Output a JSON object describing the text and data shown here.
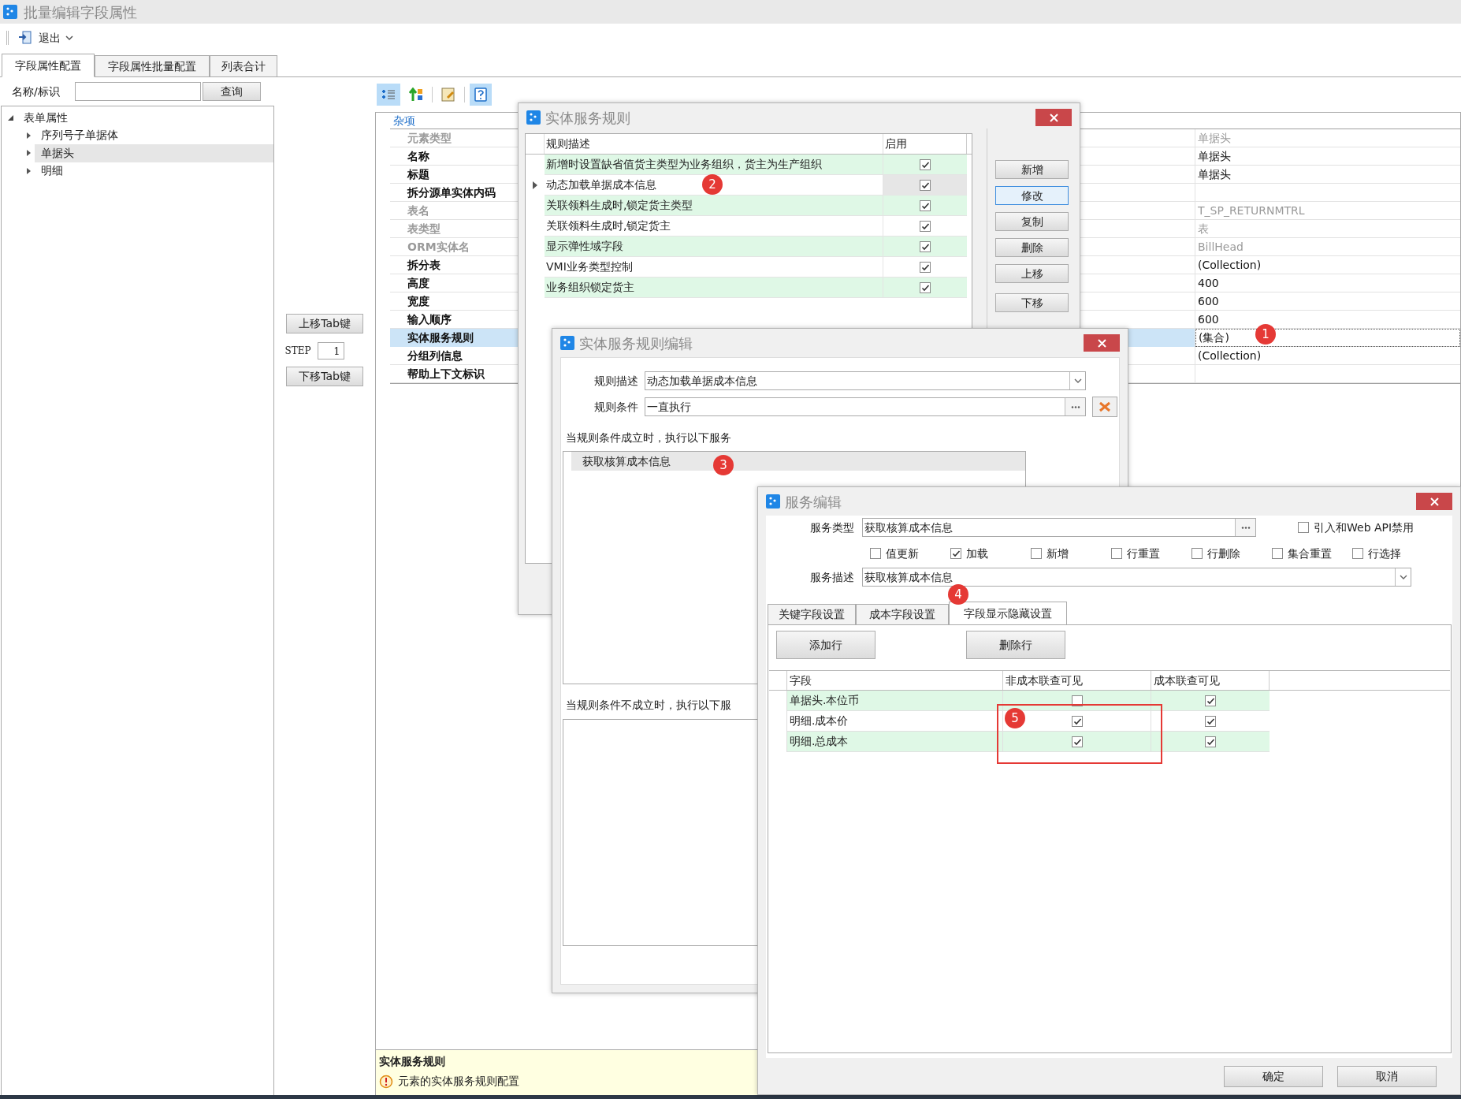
{
  "window": {
    "title": "批量编辑字段属性"
  },
  "toolbar": {
    "exit_button": "退出"
  },
  "tabs": [
    {
      "label": "字段属性配置",
      "selected": true
    },
    {
      "label": "字段属性批量配置",
      "selected": false
    },
    {
      "label": "列表合计",
      "selected": false
    }
  ],
  "search": {
    "label": "名称/标识",
    "button": "查询"
  },
  "tree": [
    {
      "label": "表单属性",
      "expanded": true,
      "selected": false,
      "children": [
        {
          "label": "序列号子单据体",
          "expanded": false,
          "selected": false
        },
        {
          "label": "单据头",
          "expanded": false,
          "selected": true
        },
        {
          "label": "明细",
          "expanded": false,
          "selected": false
        }
      ]
    }
  ],
  "tab_order": {
    "up_button": "上移Tab键",
    "step_label": "STEP",
    "step_value": "1",
    "down_button": "下移Tab键"
  },
  "property_grid": {
    "category": "杂项",
    "rows": [
      {
        "name": "元素类型",
        "value": "单据头",
        "readonly": true,
        "selected": false
      },
      {
        "name": "名称",
        "value": "单据头",
        "readonly": false,
        "selected": false
      },
      {
        "name": "标题",
        "value": "单据头",
        "readonly": false,
        "selected": false
      },
      {
        "name": "拆分源单实体内码",
        "readonly": false,
        "selected": false
      },
      {
        "name": "表名",
        "value": "T_SP_RETURNMTRL",
        "readonly": true,
        "selected": false
      },
      {
        "name": "表类型",
        "value": "表",
        "readonly": true,
        "selected": false
      },
      {
        "name": "ORM实体名",
        "value": "BillHead",
        "readonly": true,
        "selected": false
      },
      {
        "name": "拆分表",
        "value": "(Collection)",
        "readonly": false,
        "selected": false
      },
      {
        "name": "高度",
        "value": "400",
        "readonly": false,
        "selected": false
      },
      {
        "name": "宽度",
        "value": "600",
        "readonly": false,
        "selected": false
      },
      {
        "name": "输入顺序",
        "value": "600",
        "readonly": false,
        "selected": false
      },
      {
        "name": "实体服务规则",
        "value": "(集合)",
        "readonly": false,
        "selected": true
      },
      {
        "name": "分组列信息",
        "value": "(Collection)",
        "readonly": false,
        "selected": false
      },
      {
        "name": "帮助上下文标识",
        "readonly": false,
        "selected": false
      }
    ]
  },
  "description": {
    "title": "实体服务规则",
    "text": "元素的实体服务规则配置"
  },
  "rules_dialog": {
    "title": "实体服务规则",
    "columns": [
      "规则描述",
      "启用"
    ],
    "rows": [
      {
        "description": "新增时设置缺省值货主类型为业务组织，货主为生产组织",
        "enabled": true,
        "current": false
      },
      {
        "description": "动态加载单据成本信息",
        "enabled": true,
        "current": true
      },
      {
        "description": "关联领料生成时,锁定货主类型",
        "enabled": true,
        "current": false
      },
      {
        "description": "关联领料生成时,锁定货主",
        "enabled": true,
        "current": false
      },
      {
        "description": "显示弹性域字段",
        "enabled": true,
        "current": false
      },
      {
        "description": "VMI业务类型控制",
        "enabled": true,
        "current": false
      },
      {
        "description": "业务组织锁定货主",
        "enabled": true,
        "current": false
      }
    ],
    "buttons": [
      {
        "label": "新增",
        "focused": false
      },
      {
        "label": "修改",
        "focused": true
      },
      {
        "label": "复制",
        "focused": false
      },
      {
        "label": "删除",
        "focused": false
      },
      {
        "label": "上移",
        "focused": false
      },
      {
        "label": "下移",
        "focused": false
      }
    ]
  },
  "rule_edit_dialog": {
    "title": "实体服务规则编辑",
    "description_label": "规则描述",
    "description_value": "动态加载单据成本信息",
    "condition_label": "规则条件",
    "condition_value": "一直执行",
    "true_label": "当规则条件成立时，执行以下服务",
    "true_services": [
      {
        "label": "获取核算成本信息",
        "selected": true
      }
    ],
    "false_label": "当规则条件不成立时，执行以下服"
  },
  "service_dialog": {
    "title": "服务编辑",
    "type_label": "服务类型",
    "type_value": "获取核算成本信息",
    "webapi_label": "引入和Web API禁用",
    "webapi_checked": false,
    "options": [
      {
        "label": "值更新",
        "checked": false
      },
      {
        "label": "加载",
        "checked": true
      },
      {
        "label": "新增",
        "checked": false
      },
      {
        "label": "行重置",
        "checked": false
      },
      {
        "label": "行删除",
        "checked": false
      },
      {
        "label": "集合重置",
        "checked": false
      },
      {
        "label": "行选择",
        "checked": false
      }
    ],
    "desc_label": "服务描述",
    "desc_value": "获取核算成本信息",
    "tabs": [
      {
        "label": "关键字段设置",
        "selected": false
      },
      {
        "label": "成本字段设置",
        "selected": false
      },
      {
        "label": "字段显示隐藏设置",
        "selected": true
      }
    ],
    "add_row_button": "添加行",
    "delete_row_button": "删除行",
    "columns": [
      "字段",
      "非成本联查可见",
      "成本联查可见"
    ],
    "rows": [
      {
        "field": "单据头.本位币",
        "non_cost_visible": false,
        "cost_visible": true
      },
      {
        "field": "明细.成本价",
        "non_cost_visible": true,
        "cost_visible": true
      },
      {
        "field": "明细.总成本",
        "non_cost_visible": true,
        "cost_visible": true
      }
    ],
    "ok_button": "确定",
    "cancel_button": "取消"
  },
  "annotations": [
    {
      "label": "1"
    },
    {
      "label": "2"
    },
    {
      "label": "3"
    },
    {
      "label": "4"
    },
    {
      "label": "5"
    }
  ]
}
